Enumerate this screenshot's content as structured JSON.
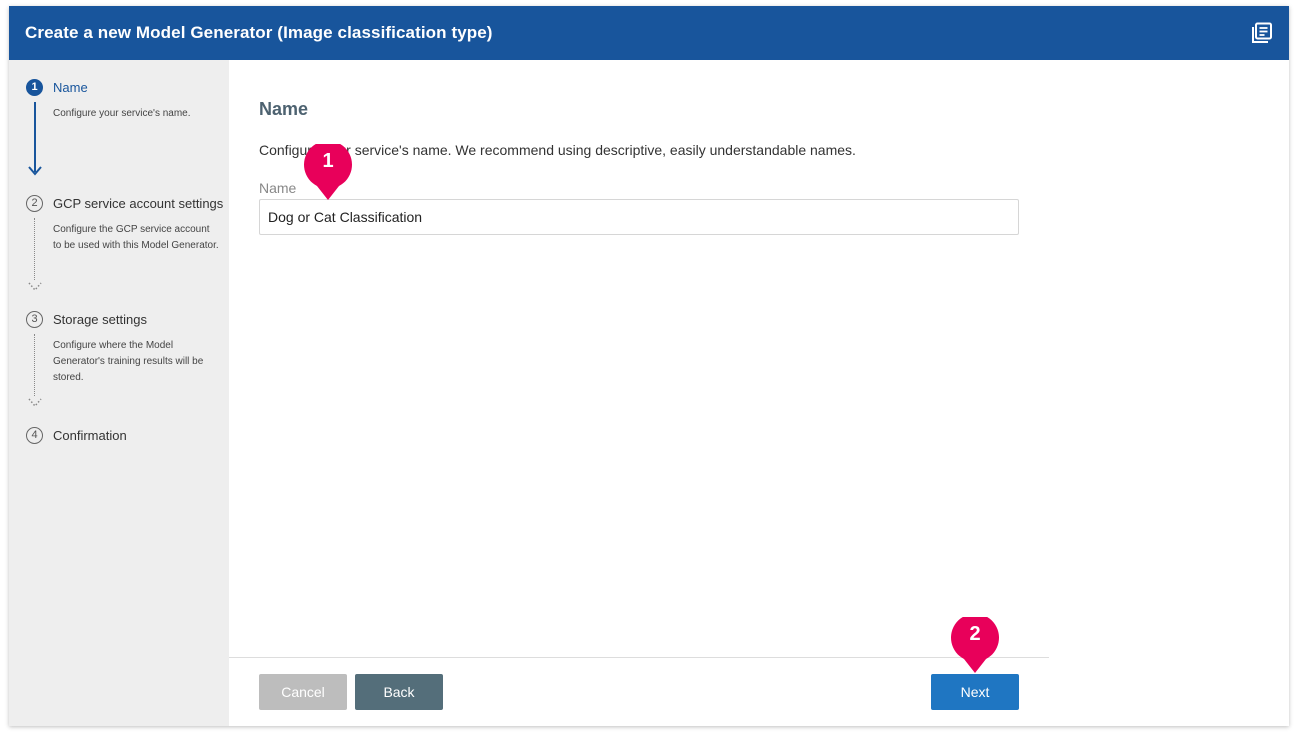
{
  "header": {
    "title": "Create a new Model Generator (Image classification type)",
    "icon": "document-list-icon",
    "background": "#18559c"
  },
  "steps": [
    {
      "number": "1",
      "title": "Name",
      "description": "Configure your service's name.",
      "status": "active"
    },
    {
      "number": "2",
      "title": "GCP service account settings",
      "description": "Configure the GCP service account to be used with this Model Generator.",
      "status": "pending"
    },
    {
      "number": "3",
      "title": "Storage settings",
      "description": "Configure where the Model Generator's training results will be stored.",
      "status": "pending"
    },
    {
      "number": "4",
      "title": "Confirmation",
      "description": "",
      "status": "pending"
    }
  ],
  "main": {
    "title": "Name",
    "description": "Configure your service's name. We recommend using descriptive, easily understandable names.",
    "field_label": "Name",
    "name_value": "Dog or Cat Classification"
  },
  "buttons": {
    "cancel": "Cancel",
    "back": "Back",
    "next": "Next"
  },
  "markers": [
    "1",
    "2"
  ],
  "colors": {
    "accent": "#18559c",
    "marker": "#e8005a",
    "next_button": "#1f76c2",
    "back_button": "#546e7a"
  }
}
